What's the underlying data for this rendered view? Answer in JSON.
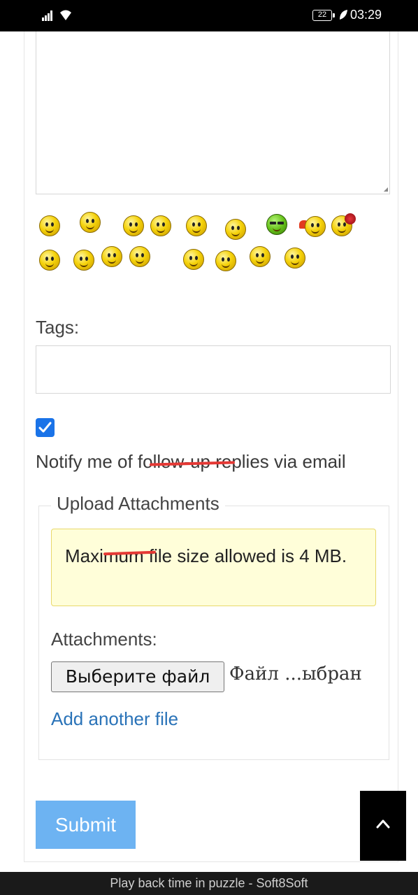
{
  "status_bar": {
    "battery": "22",
    "time": "03:29"
  },
  "form": {
    "tags_label": "Tags:",
    "notify": {
      "checked": true,
      "label": "Notify me of follow-up replies via email"
    },
    "attachments": {
      "legend": "Upload Attachments",
      "notice_text": "Maximum file size allowed is 4 MB.",
      "label": "Attachments:",
      "choose_file_button": "Выберите файл",
      "file_status": "Файл ...ыбран",
      "add_another_link": "Add another file"
    },
    "submit_label": "Submit"
  },
  "smileys": [
    "wave",
    "thumbs-up",
    "thinking",
    "smirk",
    "confused",
    "grin",
    "cool",
    "heart",
    "rose",
    "happy",
    "surprised",
    "smile",
    "blink",
    "exclaim",
    "sad",
    "dance",
    "wink"
  ],
  "footer_text": "Play back time in puzzle - Soft8Soft",
  "colors": {
    "accent": "#1a73e8",
    "submit": "#6db3f2",
    "link": "#2a73b8",
    "notice_bg": "#fffed9",
    "strike": "#e53935"
  }
}
